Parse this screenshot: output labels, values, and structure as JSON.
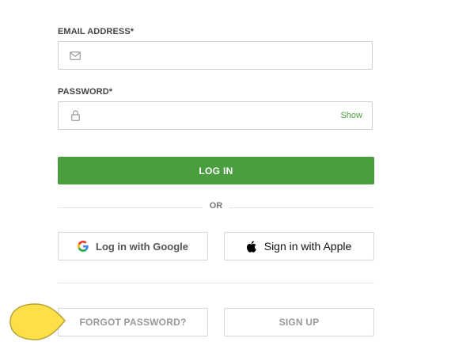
{
  "email": {
    "label": "EMAIL ADDRESS*",
    "value": "",
    "icon": "envelope-icon"
  },
  "password": {
    "label": "PASSWORD*",
    "value": "",
    "icon": "lock-icon",
    "show_label": "Show"
  },
  "login_button": {
    "label": "LOG IN",
    "color": "#4b9e3f"
  },
  "separator": {
    "label": "OR"
  },
  "social": {
    "google_label": "Log in with Google",
    "google_icon": "google-icon",
    "apple_label": "Sign in with Apple",
    "apple_icon": "apple-icon"
  },
  "footer": {
    "forgot_label": "FORGOT PASSWORD?",
    "signup_label": "SIGN UP"
  },
  "pointer": {
    "icon": "pointer-marker",
    "color": "#fde047"
  },
  "colors": {
    "accent": "#4b9e3f",
    "link": "#4a9a3c"
  }
}
